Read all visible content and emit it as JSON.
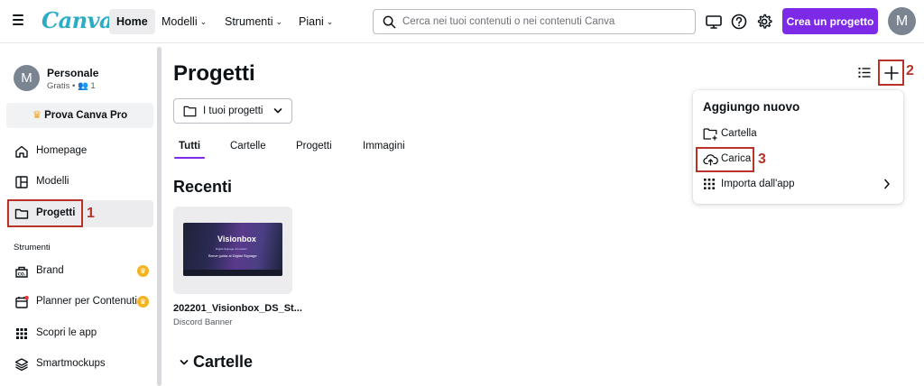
{
  "topbar": {
    "logo": "Canva",
    "nav": [
      "Home",
      "Modelli",
      "Strumenti",
      "Piani"
    ],
    "search_placeholder": "Cerca nei tuoi contenuti o nei contenuti Canva",
    "create_label": "Crea un progetto",
    "avatar_initial": "M"
  },
  "sidebar": {
    "account_initial": "M",
    "account_name": "Personale",
    "account_sub": "Gratis • 👥 1",
    "pro_label": "Prova Canva Pro",
    "items": [
      {
        "label": "Homepage",
        "icon": "home-icon"
      },
      {
        "label": "Modelli",
        "icon": "templates-icon"
      },
      {
        "label": "Progetti",
        "icon": "folder-icon"
      }
    ],
    "section_label": "Strumenti",
    "tools": [
      {
        "label": "Brand",
        "icon": "brand-icon",
        "crown": true
      },
      {
        "label": "Planner per Contenuti",
        "icon": "calendar-icon",
        "crown": true
      },
      {
        "label": "Scopri le app",
        "icon": "apps-icon",
        "crown": false
      },
      {
        "label": "Smartmockups",
        "icon": "layers-icon",
        "crown": false
      }
    ]
  },
  "main": {
    "title": "Progetti",
    "dropdown_label": "I tuoi progetti",
    "tabs": [
      "Tutti",
      "Cartelle",
      "Progetti",
      "Immagini"
    ],
    "recent_title": "Recenti",
    "recent_item": {
      "name": "202201_Visionbox_DS_St...",
      "type": "Discord Banner",
      "thumb_brand": "Visionbox",
      "thumb_tagline": "Digital Signage Innovation",
      "thumb_caption": "Breve guida al Digital Signage"
    },
    "folders_title": "Cartelle"
  },
  "popup": {
    "title": "Aggiungo nuovo",
    "items": [
      {
        "label": "Cartella",
        "icon": "folder-plus-icon"
      },
      {
        "label": "Carica",
        "icon": "cloud-upload-icon"
      },
      {
        "label": "Importa dall'app",
        "icon": "apps-grid-icon"
      }
    ]
  },
  "annotations": [
    "1",
    "2",
    "3"
  ],
  "colors": {
    "brand": "#2dacc7",
    "accent": "#7d2ae8",
    "annotation": "#b83228"
  }
}
